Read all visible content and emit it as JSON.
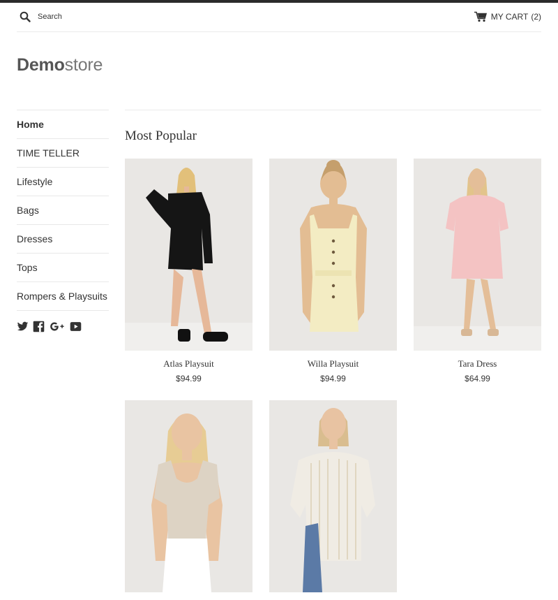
{
  "header": {
    "search_placeholder": "Search",
    "cart_label": "MY CART",
    "cart_count": "(2)"
  },
  "logo": {
    "bold": "Demo",
    "light": "store"
  },
  "sidebar": {
    "items": [
      {
        "label": "Home",
        "active": true
      },
      {
        "label": "TIME TELLER"
      },
      {
        "label": "Lifestyle"
      },
      {
        "label": "Bags"
      },
      {
        "label": "Dresses"
      },
      {
        "label": "Tops"
      },
      {
        "label": "Rompers & Playsuits"
      }
    ],
    "social_icons": [
      "twitter-icon",
      "facebook-icon",
      "google-plus-icon",
      "youtube-icon"
    ]
  },
  "main": {
    "section_title": "Most Popular",
    "products": [
      {
        "name": "Atlas Playsuit",
        "price": "$94.99",
        "color": "#111111"
      },
      {
        "name": "Willa Playsuit",
        "price": "$94.99",
        "color": "#f3ecc3"
      },
      {
        "name": "Tara Dress",
        "price": "$64.99",
        "color": "#f4c3c3"
      },
      {
        "name": "",
        "price": "",
        "color": "#ddd3c4"
      },
      {
        "name": "",
        "price": "",
        "color": "#f0ece4"
      }
    ]
  },
  "colors": {
    "topbar": "#2b2b2b",
    "photo_bg": "#e9e7e4",
    "text": "#333333"
  }
}
